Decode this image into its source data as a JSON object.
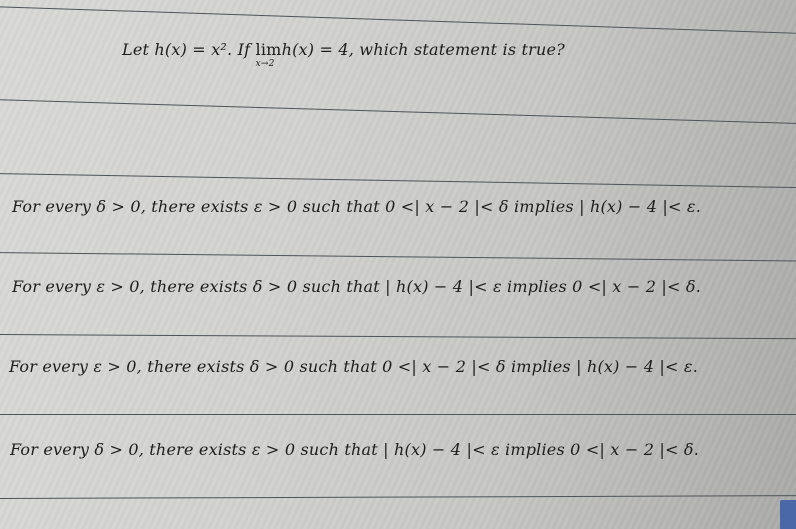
{
  "question": {
    "prefix": "Let h(x) = x². If ",
    "lim_label": "lim",
    "lim_subscript": "x→2",
    "suffix": "h(x) = 4, which statement is true?"
  },
  "options": [
    {
      "label": "For every δ > 0, there exists ε > 0 such that 0 <| x − 2 |< δ implies | h(x) − 4 |< ε."
    },
    {
      "label": "For every ε > 0, there exists δ > 0 such that | h(x) − 4 |< ε implies 0 <| x − 2 |< δ."
    },
    {
      "label": "For every ε > 0, there exists δ > 0 such that 0 <| x − 2 |< δ implies | h(x) − 4 |< ε."
    },
    {
      "label": "For every δ > 0, there exists ε > 0 such that | h(x) − 4 |< ε implies 0 <| x − 2 |< δ."
    }
  ],
  "colors": {
    "accent_button": "#4a67a8",
    "rule": "#4e5458",
    "text": "#1d1d1d"
  }
}
